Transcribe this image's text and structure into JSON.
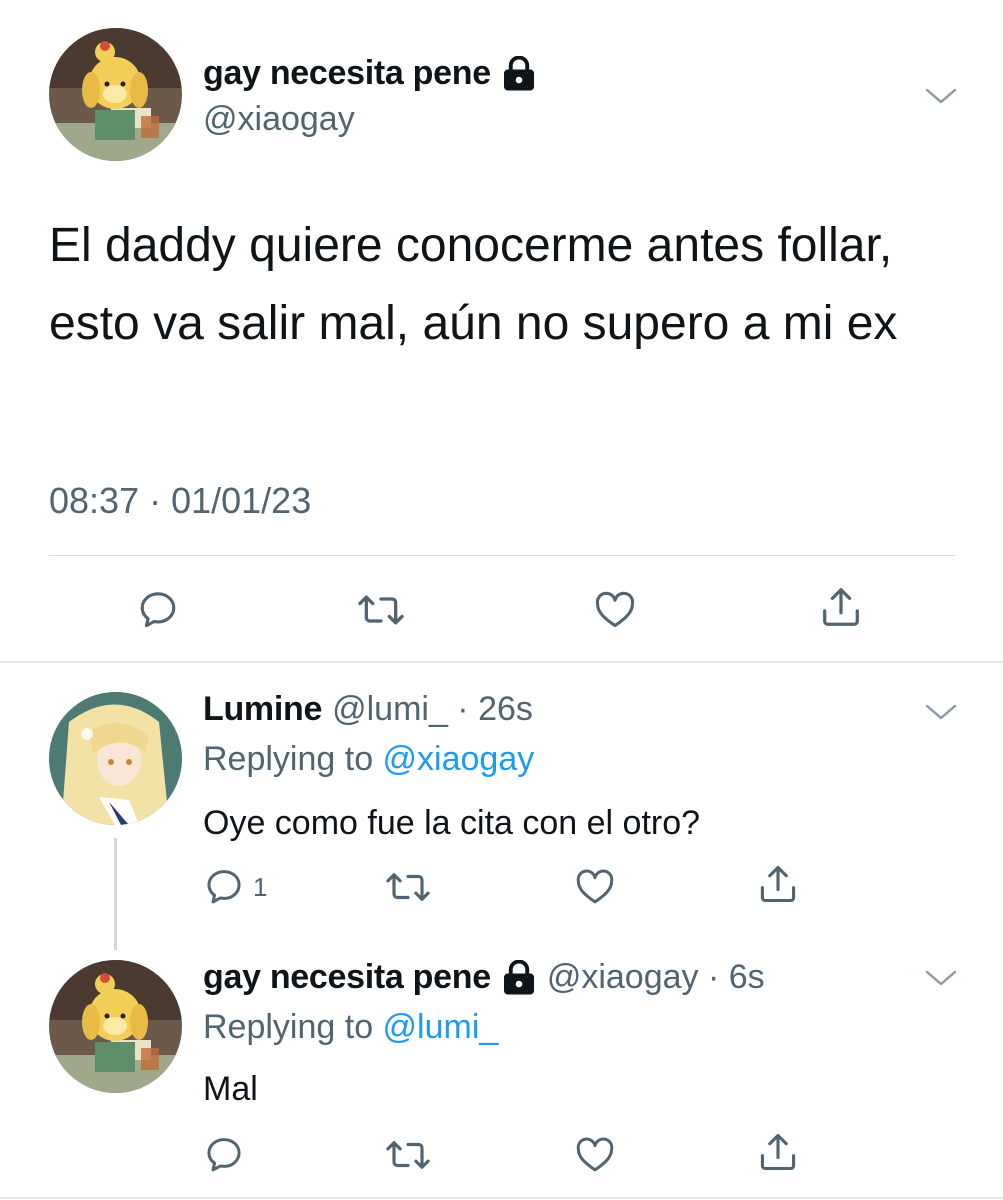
{
  "main_tweet": {
    "display_name": "gay necesita pene",
    "handle": "@xiaogay",
    "text": "El daddy quiere conocerme antes follar, esto va salir mal, aún no supero a mi ex",
    "timestamp": "08:37 · 01/01/23",
    "protected": true
  },
  "replies": [
    {
      "display_name": "Lumine",
      "handle_time": "@lumi_ · 26s",
      "replying_prefix": "Replying to ",
      "replying_to": "@xiaogay",
      "text": "Oye como fue la cita con el otro?",
      "reply_count": "1"
    },
    {
      "display_name": "gay necesita pene",
      "handle_time": "@xiaogay · 6s",
      "replying_prefix": "Replying to ",
      "replying_to": "@lumi_",
      "text": "Mal",
      "reply_count": "",
      "protected": true
    }
  ],
  "icons": {
    "reply": "reply-icon",
    "retweet": "retweet-icon",
    "like": "heart-icon",
    "share": "share-icon",
    "more": "chevron-down-icon",
    "protected": "lock-icon"
  },
  "colors": {
    "text": "#0f1419",
    "secondary": "#536471",
    "link": "#1d9bf0",
    "divider": "#e1e4e6"
  }
}
